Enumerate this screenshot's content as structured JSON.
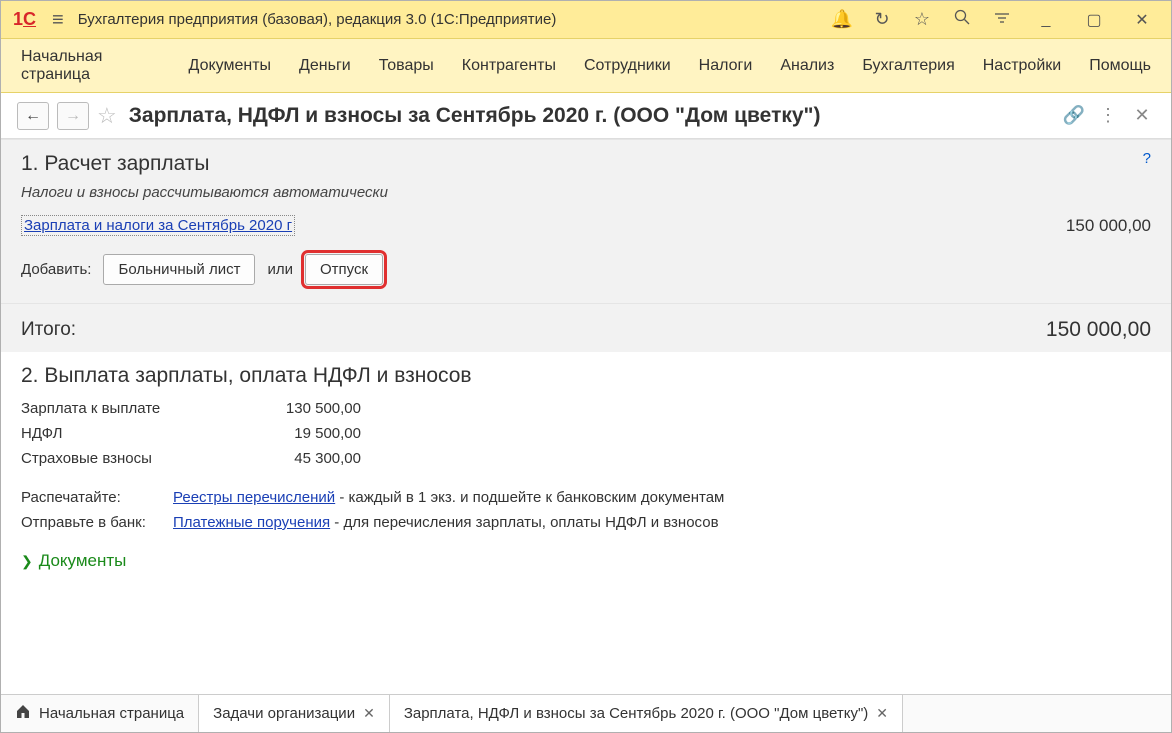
{
  "titlebar": {
    "app_name": "Бухгалтерия предприятия (базовая), редакция 3.0  (1С:Предприятие)"
  },
  "menu": {
    "items": [
      "Начальная страница",
      "Документы",
      "Деньги",
      "Товары",
      "Контрагенты",
      "Сотрудники",
      "Налоги",
      "Анализ",
      "Бухгалтерия",
      "Настройки",
      "Помощь"
    ]
  },
  "page": {
    "title": "Зарплата, НДФЛ и взносы за Сентябрь 2020 г. (ООО \"Дом цветку\")"
  },
  "section1": {
    "title": "1. Расчет зарплаты",
    "note": "Налоги и взносы рассчитываются автоматически",
    "link": "Зарплата и налоги за Сентябрь 2020 г",
    "amount": "150 000,00",
    "add_label": "Добавить:",
    "btn_sick": "Больничный лист",
    "or": "или",
    "btn_vacation": "Отпуск",
    "total_label": "Итого:",
    "total_value": "150 000,00"
  },
  "section2": {
    "title": "2. Выплата зарплаты, оплата НДФЛ и взносов",
    "rows": [
      {
        "k": "Зарплата к выплате",
        "v": "130 500,00"
      },
      {
        "k": "НДФЛ",
        "v": "19 500,00"
      },
      {
        "k": "Страховые взносы",
        "v": "45 300,00"
      }
    ],
    "print_label": "Распечатайте:",
    "print_link": "Реестры перечислений",
    "print_tail": " - каждый в 1 экз. и подшейте к банковским документам",
    "send_label": "Отправьте в банк:",
    "send_link": "Платежные поручения",
    "send_tail": " - для перечисления зарплаты, оплаты НДФЛ и взносов",
    "docs_toggle": "Документы"
  },
  "tabs": {
    "home": "Начальная страница",
    "t1": "Задачи организации",
    "t2": "Зарплата, НДФЛ и взносы за Сентябрь 2020 г. (ООО \"Дом цветку\")"
  }
}
